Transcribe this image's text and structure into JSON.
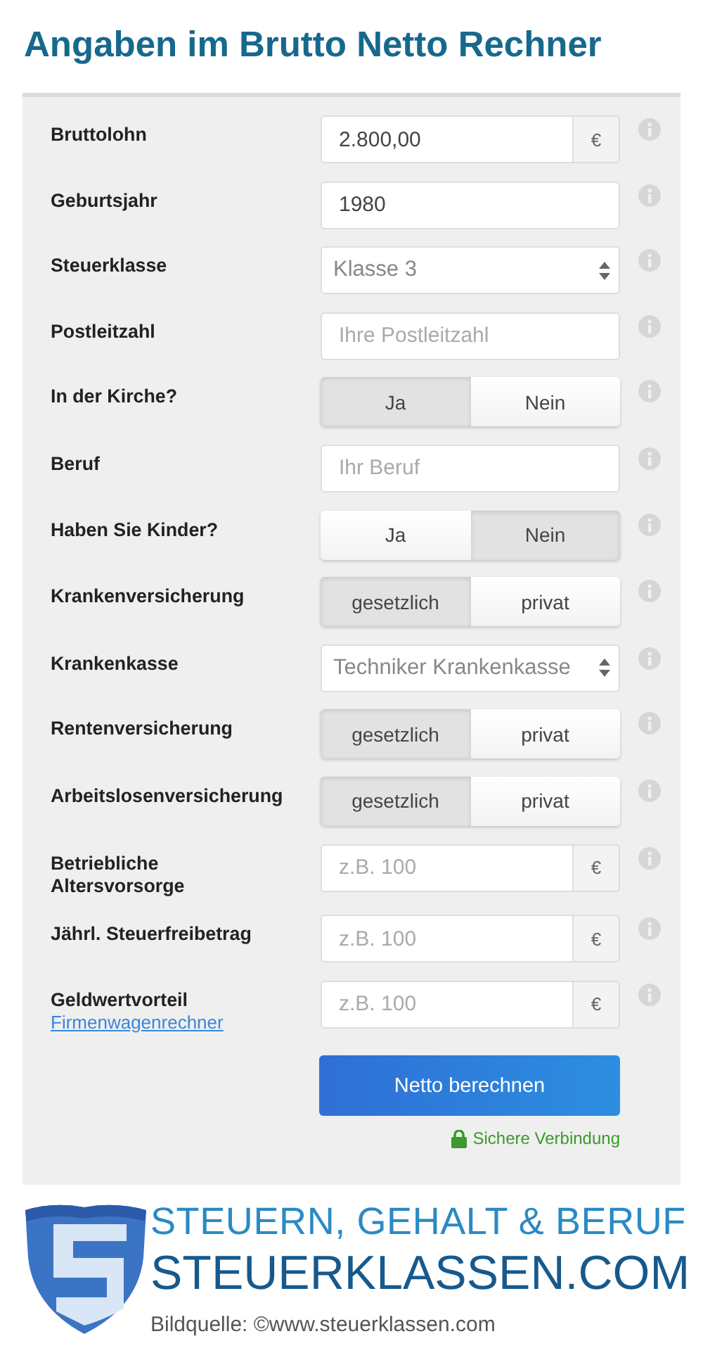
{
  "title": "Angaben im Brutto Netto Rechner",
  "fields": [
    {
      "label": "Bruttolohn",
      "kind": "money",
      "value": "2.800,00",
      "unit": "€"
    },
    {
      "label": "Geburtsjahr",
      "kind": "text",
      "value": "1980"
    },
    {
      "label": "Steuerklasse",
      "kind": "select",
      "value": "Klasse 3"
    },
    {
      "label": "Postleitzahl",
      "kind": "text",
      "placeholder": "Ihre Postleitzahl"
    },
    {
      "label": "In der Kirche?",
      "kind": "segmented",
      "options": [
        {
          "label": "Ja",
          "selected": true
        },
        {
          "label": "Nein",
          "selected": false
        }
      ]
    },
    {
      "label": "Beruf",
      "kind": "text",
      "placeholder": "Ihr Beruf"
    },
    {
      "label": "Haben Sie Kinder?",
      "kind": "segmented",
      "options": [
        {
          "label": "Ja",
          "selected": false
        },
        {
          "label": "Nein",
          "selected": true
        }
      ]
    },
    {
      "label": "Krankenversicherung",
      "kind": "segmented",
      "options": [
        {
          "label": "gesetzlich",
          "selected": true
        },
        {
          "label": "privat",
          "selected": false
        }
      ]
    },
    {
      "label": "Krankenkasse",
      "kind": "select",
      "value": "Techniker Krankenkasse"
    },
    {
      "label": "Rentenversicherung",
      "kind": "segmented",
      "options": [
        {
          "label": "gesetzlich",
          "selected": true
        },
        {
          "label": "privat",
          "selected": false
        }
      ]
    },
    {
      "label": "Arbeitslosenversicherung",
      "kind": "segmented",
      "options": [
        {
          "label": "gesetzlich",
          "selected": true
        },
        {
          "label": "privat",
          "selected": false
        }
      ]
    },
    {
      "label": "Betriebliche Altersvorsorge",
      "kind": "money",
      "placeholder": "z.B. 100",
      "unit": "€"
    },
    {
      "label": "Jährl. Steuerfreibetrag",
      "kind": "money",
      "placeholder": "z.B. 100",
      "unit": "€"
    },
    {
      "label": "Geldwertvorteil",
      "link": "Firmenwagenrechner",
      "kind": "money",
      "placeholder": "z.B. 100",
      "unit": "€"
    }
  ],
  "submit": "Netto berechnen",
  "secure_note": "Sichere Verbindung",
  "brand": {
    "tagline": "STEUERN, GEHALT & BERUF",
    "name": "STEUERKLASSEN.COM",
    "credit": "Bildquelle: ©www.steuerklassen.com"
  }
}
